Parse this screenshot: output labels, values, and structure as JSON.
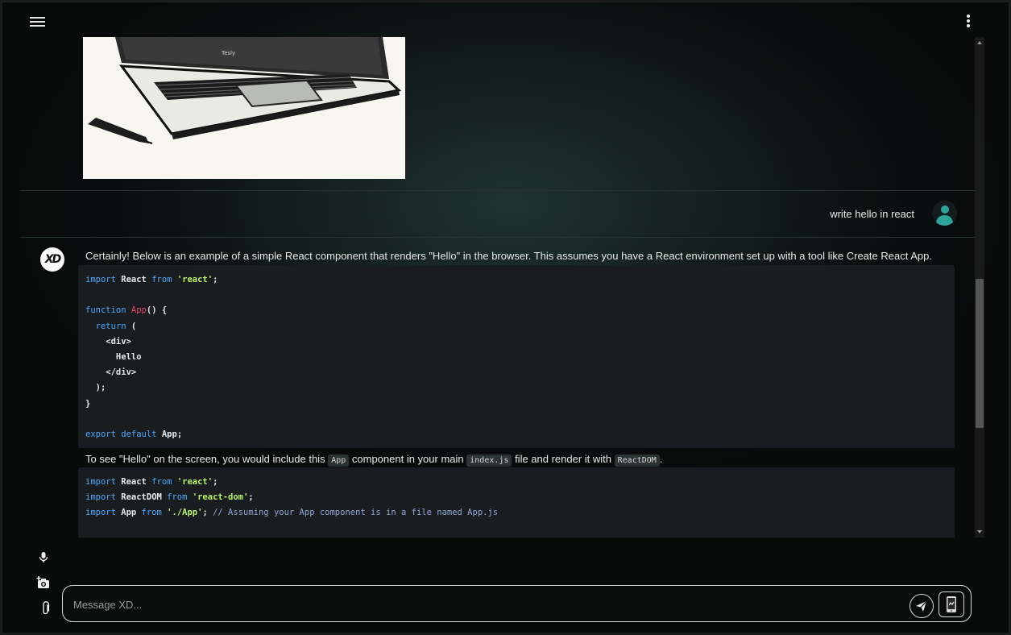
{
  "header": {
    "menu_icon": "hamburger-menu-icon",
    "more_icon": "vertical-ellipsis-icon"
  },
  "conversation": {
    "generated_image": {
      "caption_on_laptop": "Tesly"
    },
    "user_message": {
      "text": "write hello in react",
      "avatar_icon": "user-avatar-icon"
    },
    "assistant": {
      "avatar_label": "XD",
      "intro": "Certainly! Below is an example of a simple React component that renders \"Hello\" in the browser. This assumes you have a React environment set up with a tool like Create React App.",
      "code1_lines": [
        "import React from 'react';",
        "",
        "function App() {",
        "  return (",
        "    <div>",
        "      Hello",
        "    </div>",
        "  );",
        "}",
        "",
        "export default App;"
      ],
      "followup": {
        "part1": "To see \"Hello\" on the screen, you would include this",
        "code_app": "App",
        "part2": "component in your main",
        "code_index": "index.js",
        "part3": "file and render it with",
        "code_reactdom": "ReactDOM",
        "part4": "."
      },
      "code2_lines": [
        "import React from 'react';",
        "import ReactDOM from 'react-dom';",
        "import App from './App'; // Assuming your App component is in a file named App.js"
      ]
    }
  },
  "composer": {
    "placeholder": "Message XD...",
    "icons": [
      "microphone-icon",
      "camera-plus-icon",
      "paperclip-icon",
      "send-icon",
      "app-switch-icon"
    ]
  },
  "colors": {
    "accent_teal": "#2fa39a",
    "keyword": "#4fa8ff",
    "string": "#b8f070",
    "function_name": "#e2456b"
  }
}
